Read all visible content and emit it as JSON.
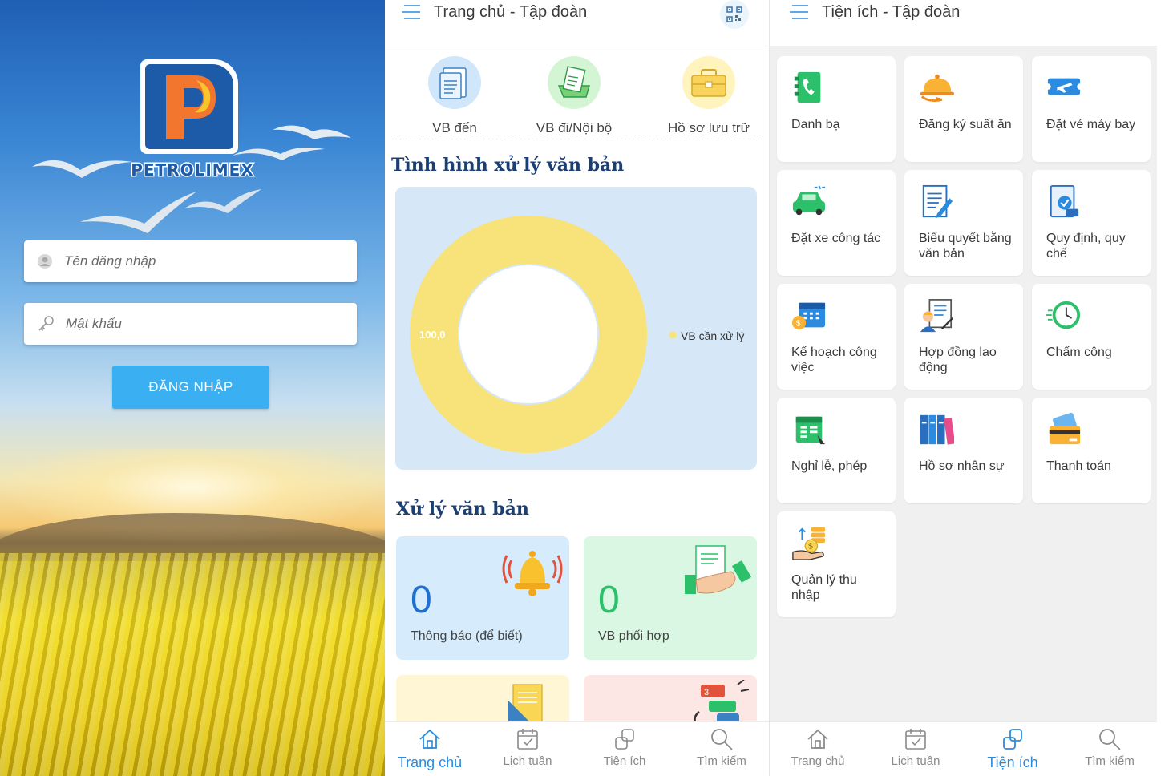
{
  "login": {
    "logo_text": "PETROLIMEX",
    "username_placeholder": "Tên đăng nhập",
    "password_placeholder": "Mật khẩu",
    "login_button": "ĐĂNG NHẬP"
  },
  "home": {
    "title": "Trang chủ - Tập đoàn",
    "quick_links": [
      {
        "label": "VB đến",
        "icon": "document-icon",
        "color": "#cfe6fb"
      },
      {
        "label": "VB đi/Nội bộ",
        "icon": "document-sent-icon",
        "color": "#d4f5d4"
      },
      {
        "label": "Hồ sơ lưu trữ",
        "icon": "briefcase-icon",
        "color": "#fff4bd"
      }
    ],
    "status_section_title": "Tình hình xử lý văn bản",
    "processing_section_title": "Xử lý văn bản",
    "cards": [
      {
        "count": "0",
        "label": "Thông báo (để biết)",
        "icon": "bell-icon",
        "bg": "#d6ebfb",
        "num_color": "#1f6fd0"
      },
      {
        "count": "0",
        "label": "VB phối hợp",
        "icon": "handshake-icon",
        "bg": "#d9f7e2",
        "num_color": "#2cc06a"
      },
      {
        "count": "",
        "label": "",
        "icon": "file-icon",
        "bg": "#fff6d6",
        "num_color": "#d4a900"
      },
      {
        "count": "",
        "label": "",
        "icon": "chat-icon",
        "bg": "#fde7e4",
        "num_color": "#e0543c"
      }
    ]
  },
  "chart_data": {
    "type": "pie",
    "title": "",
    "labels": [
      "VB cần xử lý"
    ],
    "values": [
      100.0
    ],
    "value_labels": [
      "100,0"
    ],
    "colors": [
      "#f8e27a"
    ],
    "donut": true,
    "legend_position": "right"
  },
  "utilities": {
    "title": "Tiện ích - Tập đoàn",
    "items": [
      {
        "label": "Danh bạ",
        "icon": "contacts-icon"
      },
      {
        "label": "Đăng ký suất ăn",
        "icon": "meal-icon"
      },
      {
        "label": "Đặt vé máy bay",
        "icon": "plane-ticket-icon"
      },
      {
        "label": "Đặt xe công tác",
        "icon": "car-icon"
      },
      {
        "label": "Biểu quyết bằng văn bản",
        "icon": "vote-document-icon"
      },
      {
        "label": "Quy định, quy chế",
        "icon": "regulation-icon"
      },
      {
        "label": "Kế hoạch công việc",
        "icon": "calendar-plan-icon"
      },
      {
        "label": "Hợp đồng lao động",
        "icon": "contract-icon"
      },
      {
        "label": "Chấm công",
        "icon": "clock-icon"
      },
      {
        "label": "Nghỉ lễ, phép",
        "icon": "holiday-calendar-icon"
      },
      {
        "label": "Hồ sơ nhân sự",
        "icon": "binders-icon"
      },
      {
        "label": "Thanh toán",
        "icon": "payment-card-icon"
      },
      {
        "label": "Quản lý thu nhập",
        "icon": "income-icon"
      }
    ]
  },
  "bottom_nav": [
    {
      "label": "Trang chủ",
      "icon": "home-icon"
    },
    {
      "label": "Lịch tuần",
      "icon": "calendar-icon"
    },
    {
      "label": "Tiện ích",
      "icon": "utilities-icon"
    },
    {
      "label": "Tìm kiếm",
      "icon": "search-icon"
    }
  ]
}
